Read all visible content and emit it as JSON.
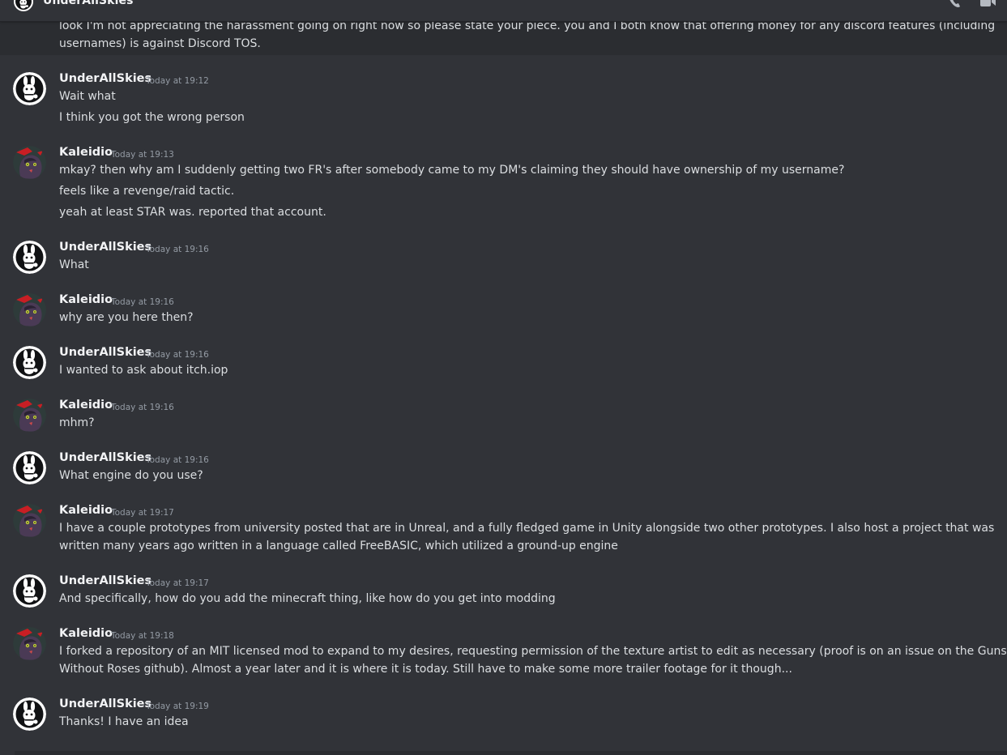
{
  "header": {
    "title": "UnderAllSkies",
    "call_icon": "phone-call-icon",
    "video_icon": "video-camera-icon"
  },
  "colors": {
    "background": "#313338",
    "text": "#dbdee1",
    "author": "#f2f3f5",
    "timestamp": "#949ba4"
  },
  "messages": [
    {
      "author": "",
      "timestamp": "",
      "lines": [
        "look I'm not appreciating the harassment going on right now so please state your piece.  you and I both know that offering money for any discord features (including",
        "usernames) is against Discord TOS."
      ]
    },
    {
      "author": "UnderAllSkies",
      "timestamp": "Today at 19:12",
      "lines": [
        "Wait what",
        "I think you got the wrong person"
      ]
    },
    {
      "author": "Kaleidio",
      "timestamp": "Today at 19:13",
      "lines": [
        "mkay?  then why am I suddenly getting two FR's after somebody came to my DM's claiming they should have ownership of my username?",
        "feels like a revenge/raid tactic.",
        "yeah at least STAR was.  reported that account."
      ]
    },
    {
      "author": "UnderAllSkies",
      "timestamp": "Today at 19:16",
      "lines": [
        "What"
      ]
    },
    {
      "author": "Kaleidio",
      "timestamp": "Today at 19:16",
      "lines": [
        "why are you here then?"
      ]
    },
    {
      "author": "UnderAllSkies",
      "timestamp": "Today at 19:16",
      "lines": [
        "I wanted to ask about itch.iop"
      ]
    },
    {
      "author": "Kaleidio",
      "timestamp": "Today at 19:16",
      "lines": [
        "mhm?"
      ]
    },
    {
      "author": "UnderAllSkies",
      "timestamp": "Today at 19:16",
      "lines": [
        "What engine do you use?"
      ]
    },
    {
      "author": "Kaleidio",
      "timestamp": "Today at 19:17",
      "lines": [
        "I have a couple prototypes from university posted that are in Unreal, and a fully fledged game in Unity alongside two other prototypes.  I also host a project that was",
        "written many years ago written in a language called FreeBASIC, which utilized a ground-up engine"
      ]
    },
    {
      "author": "UnderAllSkies",
      "timestamp": "Today at 19:17",
      "lines": [
        "And specifically, how do you add the minecraft thing, like how do you get into modding"
      ]
    },
    {
      "author": "Kaleidio",
      "timestamp": "Today at 19:18",
      "lines": [
        "I forked a repository of an MIT licensed mod to expand to my desires, requesting permission of the texture artist to edit as necessary (proof is on an issue on the Guns",
        "Without Roses github).  Almost a year later and it is where it is today.  Still have to make some more trailer footage for it though..."
      ]
    },
    {
      "author": "UnderAllSkies",
      "timestamp": "Today at 19:19",
      "lines": [
        "Thanks! I have an idea"
      ]
    }
  ]
}
